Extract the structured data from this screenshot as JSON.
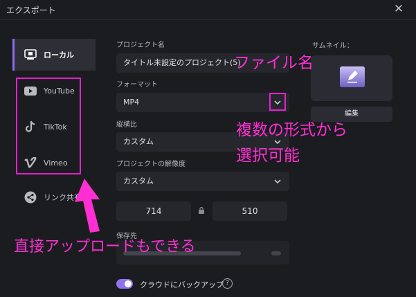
{
  "window": {
    "title": "エクスポート",
    "close_symbol": "✕"
  },
  "sidebar": {
    "items": [
      {
        "label": "ローカル",
        "icon": "local-export-icon"
      },
      {
        "label": "YouTube",
        "icon": "youtube-icon"
      },
      {
        "label": "TikTok",
        "icon": "tiktok-icon"
      },
      {
        "label": "Vimeo",
        "icon": "vimeo-icon"
      },
      {
        "label": "リンク共有",
        "icon": "share-icon"
      }
    ]
  },
  "form": {
    "project_name_label": "プロジェクト名",
    "project_name_value": "タイトル未設定のプロジェクト(5)",
    "format_label": "フォーマット",
    "format_value": "MP4",
    "aspect_label": "縦横比",
    "aspect_value": "カスタム",
    "resolution_label": "プロジェクトの解像度",
    "resolution_value": "カスタム",
    "width": "714",
    "height": "510",
    "save_to_label": "保存先",
    "cloud_backup_label": "クラウドにバックアップ",
    "cloud_backup_on": true,
    "help_symbol": "?"
  },
  "thumbnail": {
    "label": "サムネイル：",
    "edit_label": "編集"
  },
  "annotations": {
    "file_name": "ファイル名",
    "formats_line1": "複数の形式から",
    "formats_line2": "選択可能",
    "direct_upload": "直接アップロードもできる"
  },
  "colors": {
    "accent": "#8f72f2",
    "annotation": "#ff2fd3",
    "background": "#1b1c20"
  }
}
